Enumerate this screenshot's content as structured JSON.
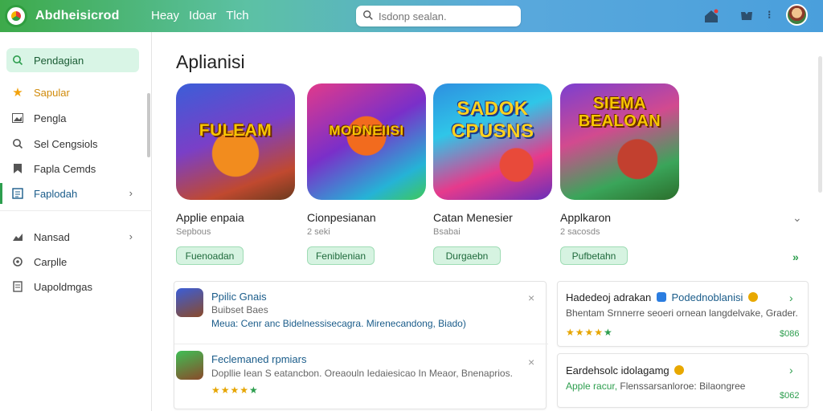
{
  "header": {
    "brand": "Abdheisicrod",
    "nav": [
      "Heay",
      "Idoar",
      "Tlch"
    ],
    "search_placeholder": "Isdonp sealan."
  },
  "sidebar": {
    "items": [
      {
        "label": "Pendagian",
        "icon": "search-icon"
      },
      {
        "label": "Sapular",
        "icon": "star-icon"
      },
      {
        "label": "Pengla",
        "icon": "image-icon"
      },
      {
        "label": "Sel Cengsiols",
        "icon": "search-icon"
      },
      {
        "label": "Fapla Cemds",
        "icon": "bookmark-icon"
      },
      {
        "label": "Faplodah",
        "icon": "list-icon"
      },
      {
        "label": "Nansad",
        "icon": "chart-icon"
      },
      {
        "label": "Carplle",
        "icon": "circle-icon"
      },
      {
        "label": "Uapoldmgas",
        "icon": "document-icon"
      }
    ]
  },
  "main": {
    "title": "Aplianisi",
    "apps": [
      {
        "banner": "FULEAM",
        "name": "Applie enpaia",
        "sub": "Sepbous",
        "button": "Fuenoadan"
      },
      {
        "banner": "MODNEIISI",
        "name": "Cionpesianan",
        "sub": "2 seki",
        "button": "Feniblenian"
      },
      {
        "banner": "SADOK CPUSNS",
        "name": "Catan Menesier",
        "sub": "Bsabai",
        "button": "Durgaebn"
      },
      {
        "banner": "SIEMA BEALOAN",
        "name": "Applkaron",
        "sub": "2 sacosds",
        "button": "Pufbetahn"
      }
    ]
  },
  "list": [
    {
      "title": "Ppilic Gnais",
      "sub": "Buibset Baes",
      "link": "Meua: Cenr anc Bidelnessisecagra.  Mirenecandong, Biado)"
    },
    {
      "title": "Feclemaned rpmiars",
      "sub": "Dopllie Iean S eatancbon. Oreaouln Iedaiesicao In Meaor, Bnenaprios."
    }
  ],
  "side": [
    {
      "title": "Hadedeoj adrakan",
      "title2": "Podednoblanisi",
      "sub": "Bhentam Srnnerre seoeri ornean langdelvake, Grader.",
      "price": "$086"
    },
    {
      "title": "Eardehsolc idolagamg",
      "link": "Apple racur,",
      "sub": "Flenssarsanloroe: Bilaongree",
      "price": "$062"
    }
  ]
}
